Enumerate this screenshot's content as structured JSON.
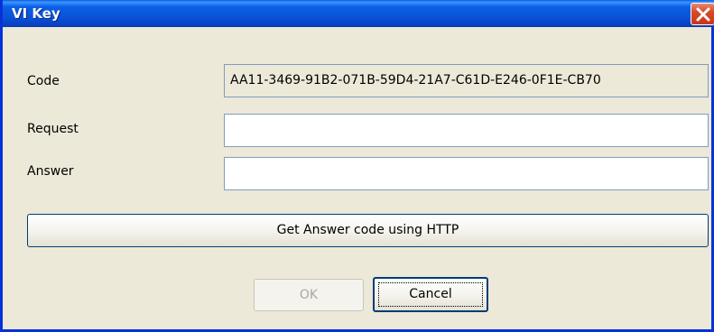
{
  "window": {
    "title": "VI Key",
    "close_icon": "close-icon"
  },
  "form": {
    "code_label": "Code",
    "code_value": "AA11-3469-91B2-071B-59D4-21A7-C61D-E246-0F1E-CB70",
    "request_label": "Request",
    "request_value": "",
    "answer_label": "Answer",
    "answer_value": ""
  },
  "buttons": {
    "http_label": "Get Answer code using HTTP",
    "ok_label": "OK",
    "cancel_label": "Cancel"
  },
  "colors": {
    "titlebar": "#0a55d9",
    "close": "#d9492a",
    "dialog_bg": "#ece9d8"
  }
}
